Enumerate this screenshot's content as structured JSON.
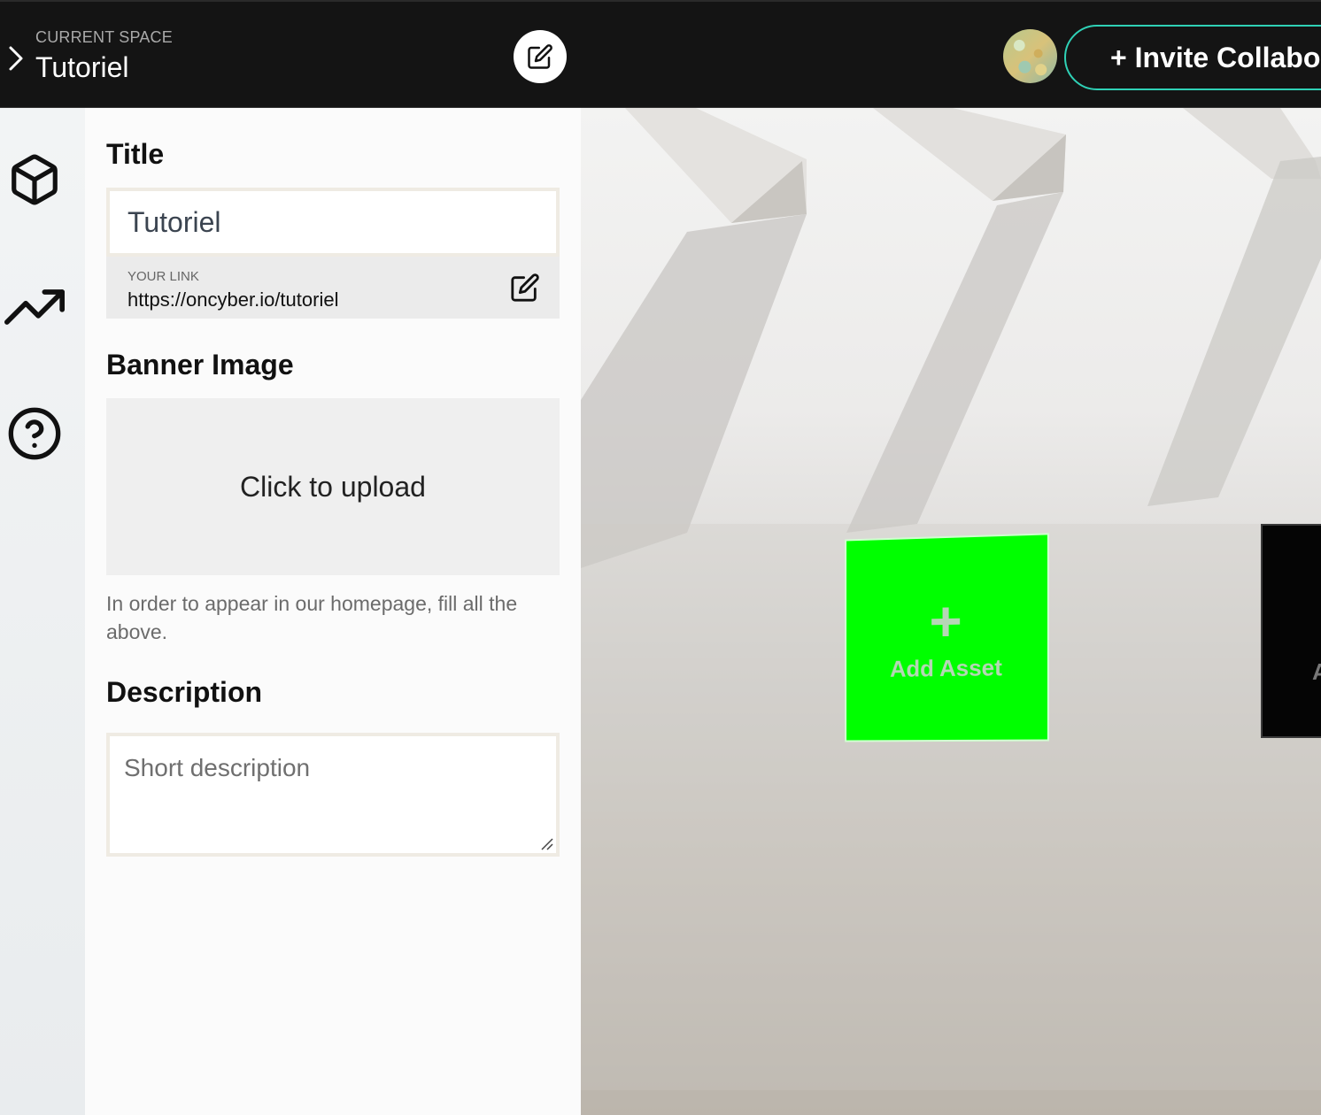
{
  "header": {
    "space_label": "CURRENT SPACE",
    "space_name": "Tutoriel",
    "invite_label": "+ Invite Collabor"
  },
  "sidebar": {
    "items": [
      {
        "icon": "cube-icon"
      },
      {
        "icon": "trending-up-icon"
      },
      {
        "icon": "help-circle-icon"
      }
    ]
  },
  "panel": {
    "title_heading": "Title",
    "title_value": "Tutoriel",
    "link_label": "YOUR LINK",
    "link_url": "https://oncyber.io/tutoriel",
    "banner_heading": "Banner Image",
    "upload_label": "Click to upload",
    "hint": "In order to appear in our homepage, fill all the above.",
    "description_heading": "Description",
    "description_placeholder": "Short description"
  },
  "scene": {
    "add_asset_label": "Add Asset",
    "add_asset_plus": "+",
    "partial_frame_text": "A",
    "add_asset_color": "#00ff00"
  },
  "colors": {
    "accent": "#2fd1b6",
    "topbar": "#141414"
  }
}
